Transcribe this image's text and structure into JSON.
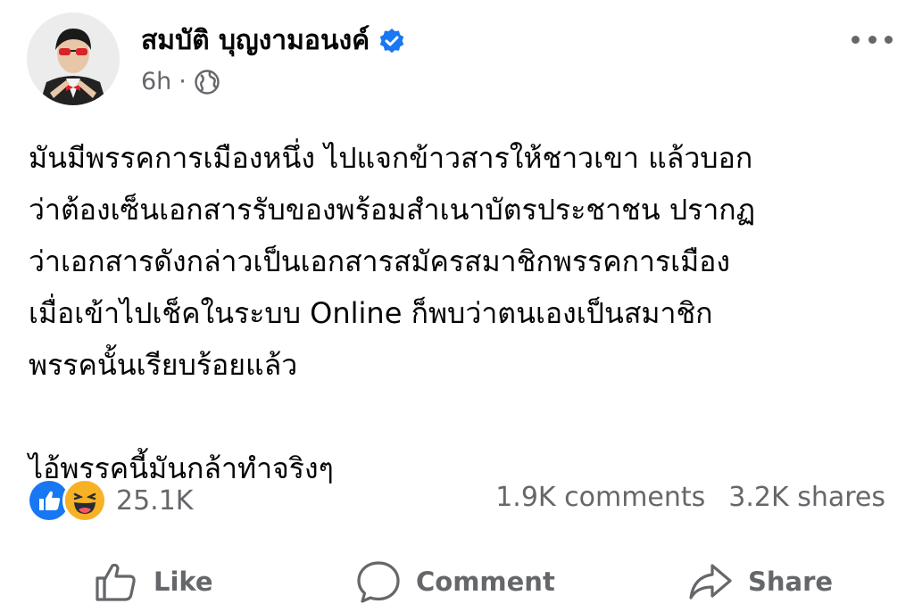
{
  "post": {
    "author_name": "สมบัติ บุญงามอนงค์",
    "time": "6h",
    "separator": "·",
    "text": "มันมีพรรคการเมืองหนึ่ง ไปแจกข้าวสารให้ชาวเขา แล้วบอก\nว่าต้องเซ็นเอกสารรับของพร้อมสำเนาบัตรประชาชน ปรากฏ\nว่าเอกสารดังกล่าวเป็นเอกสารสมัครสมาชิกพรรคการเมือง\nเมื่อเข้าไปเช็คในระบบ Online ก็พบว่าตนเองเป็นสมาชิก\nพรรคนั้นเรียบร้อยแล้ว\n\nไอ้พรรคนี้มันกล้าทำจริงๆ"
  },
  "icons": {
    "verified": "verified-badge-icon",
    "audience": "globe-icon",
    "more": "more-options-icon",
    "reaction_1": "like-reaction-icon",
    "reaction_2": "haha-reaction-icon",
    "like": "thumbs-up-icon",
    "comment": "comment-bubble-icon",
    "share": "share-arrow-icon"
  },
  "stats": {
    "reactions_count": "25.1K",
    "comments": "1.9K comments",
    "shares": "3.2K shares"
  },
  "actions": {
    "like_label": "Like",
    "comment_label": "Comment",
    "share_label": "Share"
  },
  "colors": {
    "brand_blue": "#1877f2",
    "secondary_text": "#65676b",
    "haha_yellow": "#f7b125"
  }
}
